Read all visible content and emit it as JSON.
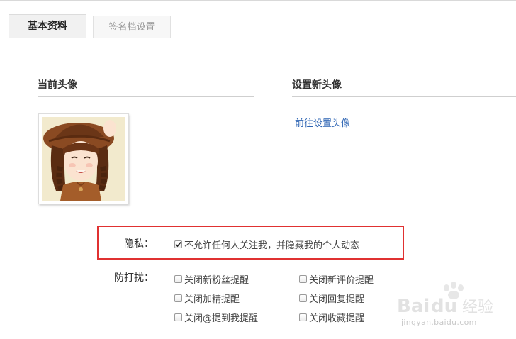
{
  "tabs": [
    {
      "label": "基本资料",
      "active": true
    },
    {
      "label": "签名档设置",
      "active": false
    }
  ],
  "sections": {
    "current_avatar_title": "当前头像",
    "new_avatar_title": "设置新头像",
    "set_avatar_link": "前往设置头像"
  },
  "privacy": {
    "label": "隐私：",
    "option": {
      "label": "不允许任何人关注我，并隐藏我的个人动态",
      "checked": true
    }
  },
  "dnd": {
    "label": "防打扰：",
    "options": [
      {
        "label": "关闭新粉丝提醒",
        "checked": false
      },
      {
        "label": "关闭新评价提醒",
        "checked": false
      },
      {
        "label": "关闭加精提醒",
        "checked": false
      },
      {
        "label": "关闭回复提醒",
        "checked": false
      },
      {
        "label": "关闭@提到我提醒",
        "checked": false
      },
      {
        "label": "关闭收藏提醒",
        "checked": false
      }
    ]
  },
  "watermark": {
    "brand": "Baidu",
    "brand_cn": "经验",
    "url": "jingyan.baidu.com"
  },
  "colors": {
    "link": "#2d64b3",
    "highlight": "#e03131"
  }
}
